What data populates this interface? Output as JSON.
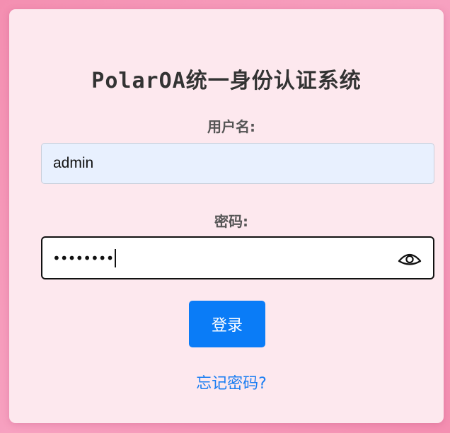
{
  "login": {
    "title": "PolarOA统一身份认证系统",
    "username_label": "用户名:",
    "username_value": "admin",
    "password_label": "密码:",
    "password_masked": "••••••••",
    "login_button": "登录",
    "forgot_link": "忘记密码?"
  },
  "icons": {
    "password_toggle": "eye-icon"
  },
  "colors": {
    "background": "#f48fb1",
    "card": "#fde8ee",
    "primary_button": "#0a7cf7",
    "link": "#1a7ef2",
    "autofill_input": "#e8f0fe"
  }
}
